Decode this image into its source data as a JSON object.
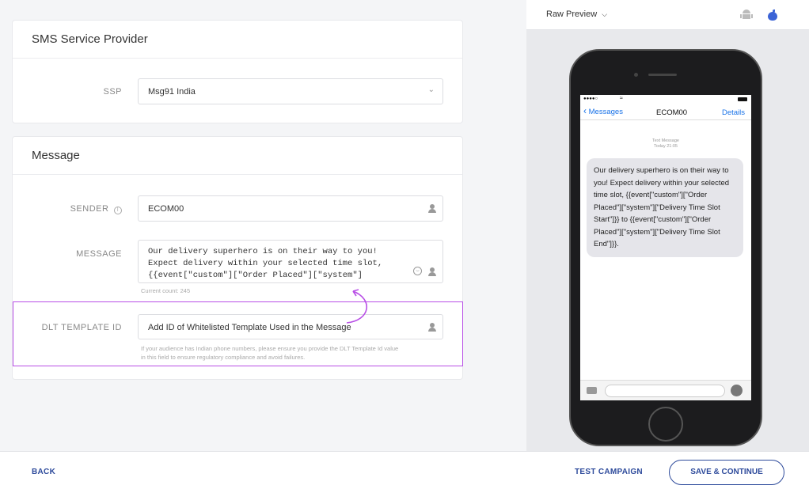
{
  "ssp_card": {
    "title": "SMS Service Provider",
    "ssp_label": "SSP",
    "ssp_value": "Msg91 India"
  },
  "message_card": {
    "title": "Message",
    "sender_label": "SENDER",
    "sender_value": "ECOM00",
    "message_label": "MESSAGE",
    "message_line1": "Our delivery superhero is on their way to you!",
    "message_line2": "Expect delivery within your selected time slot,",
    "message_line3": "{{event[\"custom\"][\"Order Placed\"][\"system\"]",
    "current_count": "Current count: 245",
    "dlt_label": "DLT TEMPLATE ID",
    "dlt_placeholder": "Add ID of Whitelisted Template Used in the Message",
    "dlt_hint_line1": "If your audience has Indian phone numbers, please ensure you provide the DLT Template Id value",
    "dlt_hint_line2": "in this field to ensure regulatory compliance and avoid failures."
  },
  "preview": {
    "mode_label": "Raw Preview",
    "status_left": "●●●●○",
    "back_label": "Messages",
    "contact": "ECOM00",
    "details_label": "Details",
    "text_message_label": "Text Message",
    "time_label": "Today 21:05",
    "bubble_text": "Our delivery superhero is on their way to you! Expect delivery within your selected time slot, {{event[\"custom\"][\"Order Placed\"][\"system\"][\"Delivery Time Slot Start\"]}} to {{event[\"custom\"][\"Order Placed\"][\"system\"][\"Delivery Time Slot End\"]}}."
  },
  "footer": {
    "back_label": "BACK",
    "test_label": "TEST CAMPAIGN",
    "save_label": "SAVE & CONTINUE"
  },
  "colors": {
    "accent": "#2d4a9b",
    "highlight": "#b84ee6",
    "ios_blue": "#1a73e8"
  }
}
